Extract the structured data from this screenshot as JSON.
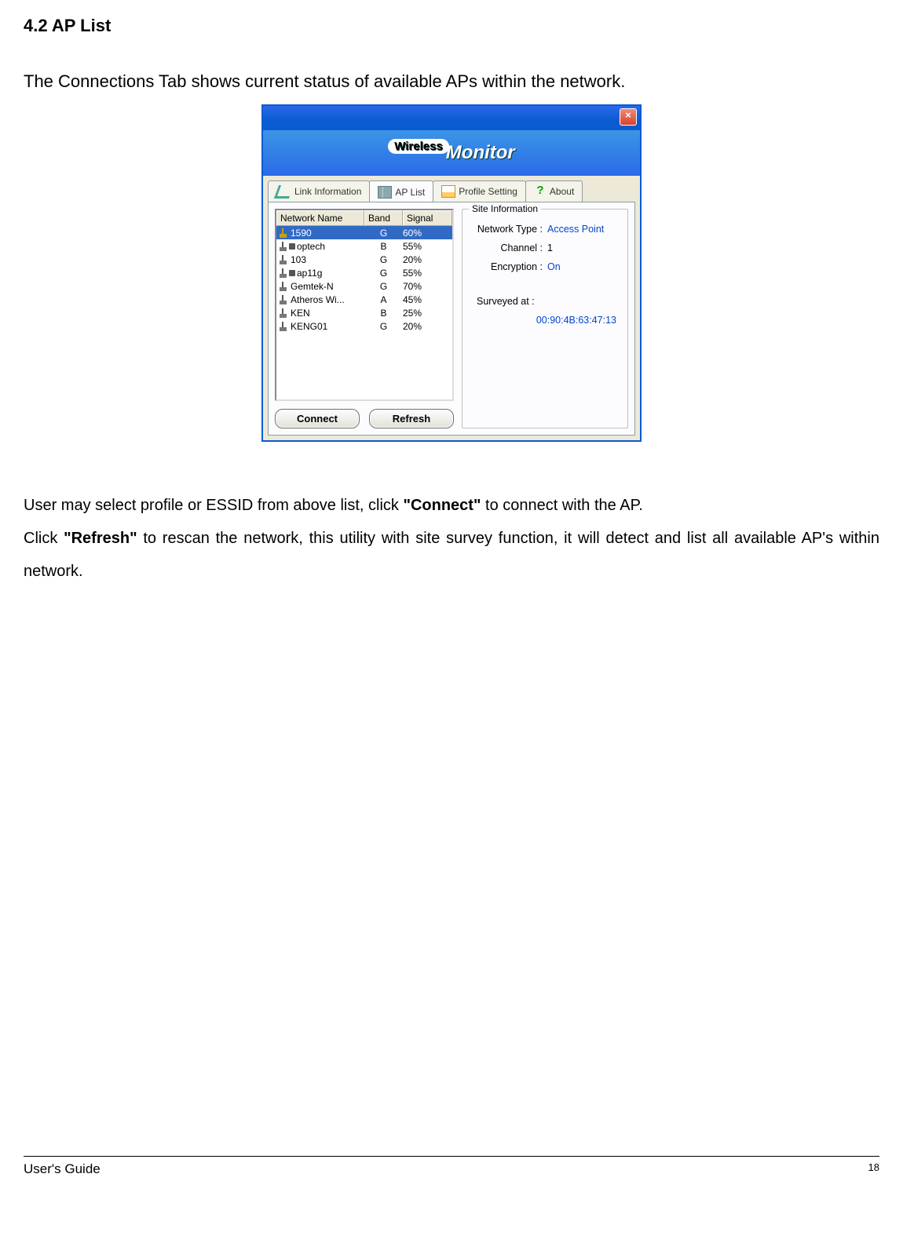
{
  "section_title": "4.2 AP List",
  "intro_text": "The Connections Tab shows current status of available APs within the network.",
  "window": {
    "banner_wireless": "Wireless",
    "banner_monitor": "Monitor",
    "tabs": {
      "link_info": "Link Information",
      "ap_list": "AP List",
      "profile": "Profile Setting",
      "about": "About"
    },
    "columns": {
      "name": "Network Name",
      "band": "Band",
      "signal": "Signal"
    },
    "rows": [
      {
        "name": "1590",
        "band": "G",
        "signal": "60%",
        "locked": true,
        "selected": true,
        "key_icon": true
      },
      {
        "name": "optech",
        "band": "B",
        "signal": "55%",
        "locked": true
      },
      {
        "name": "103",
        "band": "G",
        "signal": "20%"
      },
      {
        "name": "ap11g",
        "band": "G",
        "signal": "55%",
        "locked": true
      },
      {
        "name": "Gemtek-N",
        "band": "G",
        "signal": "70%"
      },
      {
        "name": "Atheros Wi...",
        "band": "A",
        "signal": "45%"
      },
      {
        "name": "KEN",
        "band": "B",
        "signal": "25%"
      },
      {
        "name": "KENG01",
        "band": "G",
        "signal": "20%"
      }
    ],
    "buttons": {
      "connect": "Connect",
      "refresh": "Refresh"
    },
    "site_info": {
      "legend": "Site Information",
      "network_type_label": "Network Type :",
      "network_type_value": "Access Point",
      "channel_label": "Channel :",
      "channel_value": "1",
      "encryption_label": "Encryption :",
      "encryption_value": "On",
      "surveyed_label": "Surveyed at :",
      "surveyed_value": "00:90:4B:63:47:13"
    }
  },
  "body": {
    "p1_before_connect": "User may select profile or ESSID from above list, click ",
    "p1_connect": "\"Connect\"",
    "p1_after_connect": " to connect with the AP.",
    "p2_before_refresh": "Click ",
    "p2_refresh": "\"Refresh\"",
    "p2_after_refresh": " to rescan the network, this utility with site survey function, it will detect and list all available AP's within network."
  },
  "footer": {
    "guide": "User's Guide",
    "page": "18"
  }
}
